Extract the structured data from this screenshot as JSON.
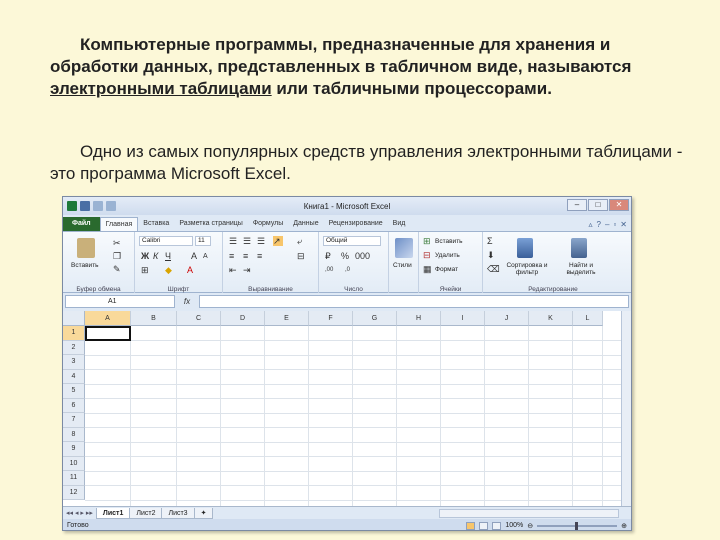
{
  "slide": {
    "para1": {
      "before": "Компьютерные программы, предназначенные для хранения и обработки данных, представленных в табличном виде, называются ",
      "underlined": "электронными таблицами",
      "after": " или табличными процессорами."
    },
    "para2": "Одно из самых популярных средств управления электронными таблицами - это программа Microsoft Excel."
  },
  "excel": {
    "title": "Книга1 - Microsoft Excel",
    "tabs": [
      "Файл",
      "Главная",
      "Вставка",
      "Разметка страницы",
      "Формулы",
      "Данные",
      "Рецензирование",
      "Вид"
    ],
    "active_tab": "Главная",
    "ribbon": {
      "paste_label": "Вставить",
      "font_name": "Calibri",
      "font_size": "11",
      "number_format": "Общий",
      "styles_label": "Стили",
      "insert_label": "Вставить",
      "delete_label": "Удалить",
      "format_label": "Формат",
      "sort_label": "Сортировка и фильтр",
      "find_label": "Найти и выделить",
      "groups": [
        "Буфер обмена",
        "Шрифт",
        "Выравнивание",
        "Число",
        "Ячейки",
        "Редактирование"
      ]
    },
    "name_box": "A1",
    "fx_label": "fx",
    "columns": [
      "A",
      "B",
      "C",
      "D",
      "E",
      "F",
      "G",
      "H",
      "I",
      "J",
      "K",
      "L"
    ],
    "rows": [
      "1",
      "2",
      "3",
      "4",
      "5",
      "6",
      "7",
      "8",
      "9",
      "10",
      "11",
      "12"
    ],
    "sheets": [
      "Лист1",
      "Лист2",
      "Лист3"
    ],
    "status": "Готово",
    "zoom": "100%",
    "colors": {
      "file_tab": "#2a6a2e",
      "selected_header": "#f9d99a",
      "window_bg": "#dfe9f5"
    }
  }
}
